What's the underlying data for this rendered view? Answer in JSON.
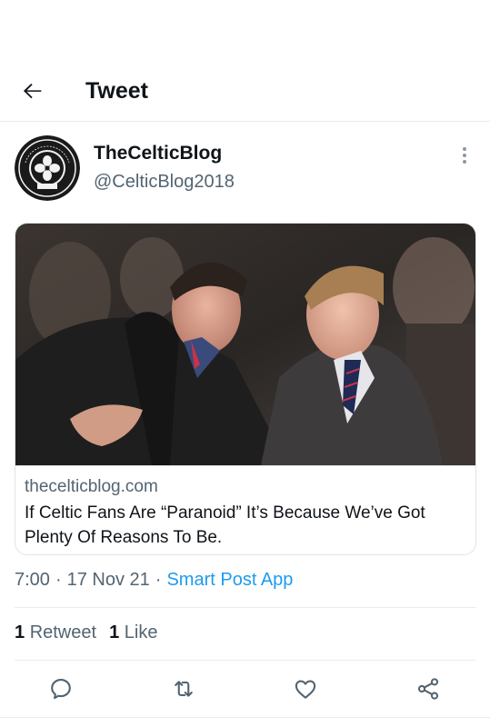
{
  "header": {
    "title": "Tweet",
    "back_icon": "arrow-left-icon"
  },
  "tweet": {
    "author": {
      "display_name": "TheCelticBlog",
      "handle": "@CelticBlog2018",
      "avatar_icon": "celtic-crest-logo",
      "avatar_text": "THE CELTIC FOOTBALL CLUB 1888"
    },
    "more_icon": "more-options-icon",
    "card": {
      "domain": "thecelticblog.com",
      "title": "If Celtic Fans Are “Paranoid” It’s Because We’ve Got Plenty Of Reasons To Be."
    },
    "time": "7:00",
    "date": "17 Nov 21",
    "separator": "·",
    "source_app": "Smart Post App",
    "stats": {
      "retweet_count": "1",
      "retweet_label": "Retweet",
      "like_count": "1",
      "like_label": "Like"
    },
    "actions": [
      "reply-icon",
      "retweet-icon",
      "like-icon",
      "share-icon"
    ]
  },
  "colors": {
    "accent": "#1d9bf0",
    "secondary_text": "#536471",
    "primary_text": "#0f1419",
    "border": "#e6ecf0"
  }
}
